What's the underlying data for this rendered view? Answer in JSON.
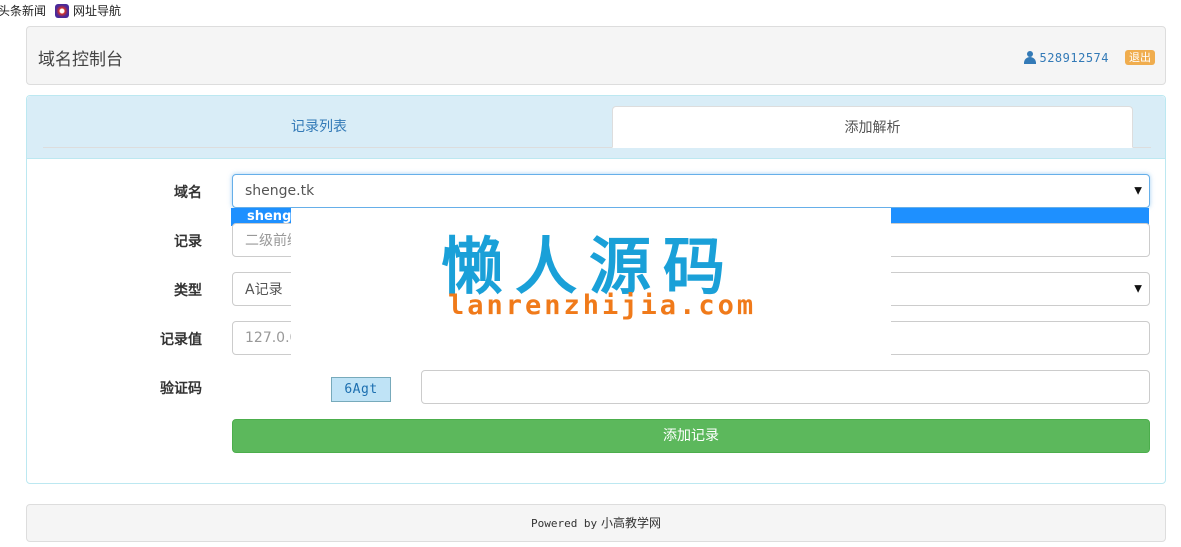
{
  "bookmarks": [
    {
      "label": "头条新闻"
    },
    {
      "label": "网址导航",
      "icon": "globe-icon"
    }
  ],
  "header": {
    "title": "域名控制台",
    "user_id": "528912574",
    "logout_label": "退出"
  },
  "tabs": [
    {
      "label": "记录列表",
      "active": false
    },
    {
      "label": "添加解析",
      "active": true
    }
  ],
  "form": {
    "domain": {
      "label": "域名",
      "value": "shenge.tk",
      "dropdown_option": "shenge"
    },
    "record": {
      "label": "记录",
      "placeholder": "二级前缀"
    },
    "type": {
      "label": "类型",
      "value": "A记录"
    },
    "record_value": {
      "label": "记录值",
      "placeholder": "127.0.0.1"
    },
    "captcha": {
      "label": "验证码",
      "image_text": "6Agt",
      "value": ""
    },
    "submit_label": "添加记录"
  },
  "watermark": {
    "cn": "懒人源码",
    "en": "lanrenzhijia.com"
  },
  "footer": {
    "prefix": "Powered by",
    "site": "小高教学网"
  },
  "colors": {
    "primary_link": "#337ab7",
    "panel_info_bg": "#d9edf7",
    "success": "#5cb85c",
    "warning": "#f0ad4e",
    "dropdown_highlight": "#1e90ff"
  }
}
